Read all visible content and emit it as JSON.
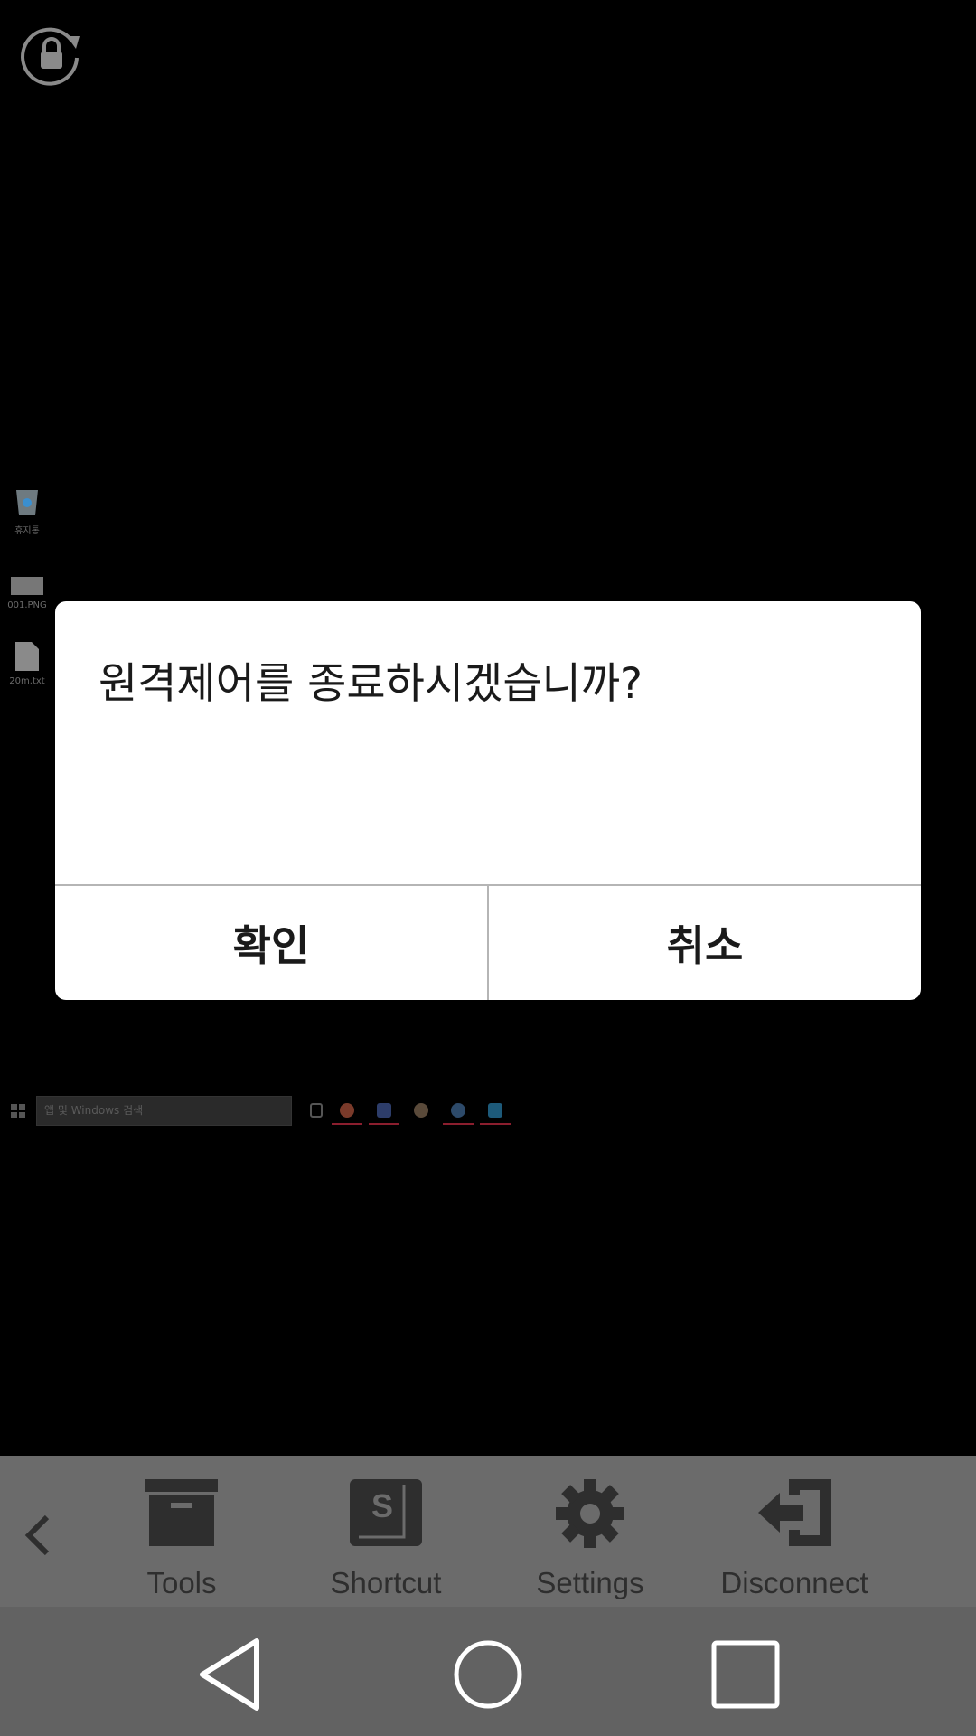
{
  "desktop": {
    "desktop_icons": [
      {
        "label": "휴지통",
        "icon": "recycle-bin-icon"
      },
      {
        "label": "001.PNG",
        "icon": "image-file-icon"
      },
      {
        "label": "20m.txt",
        "icon": "text-file-icon"
      }
    ],
    "taskbar": {
      "search_placeholder": "앱 및 Windows 검색"
    }
  },
  "dialog": {
    "message": "원격제어를 종료하시겠습니까?",
    "confirm_label": "확인",
    "cancel_label": "취소"
  },
  "toolbar": {
    "items": [
      {
        "label": "Tools",
        "icon": "archive-box-icon"
      },
      {
        "label": "Shortcut",
        "icon": "shortcut-key-icon"
      },
      {
        "label": "Settings",
        "icon": "gear-icon"
      },
      {
        "label": "Disconnect",
        "icon": "sign-out-icon"
      }
    ]
  },
  "colors": {
    "toolbar_bg": "#6b6b6b",
    "navbar_bg": "#626262",
    "dialog_bg": "#ffffff",
    "toolbar_icon": "#2e2e2e"
  }
}
